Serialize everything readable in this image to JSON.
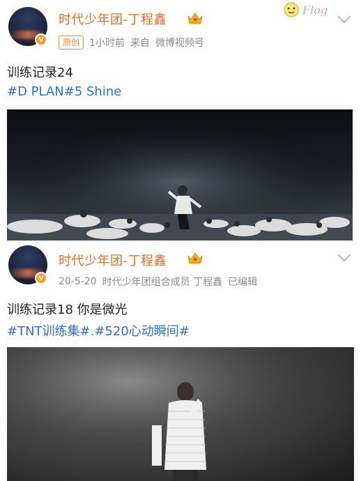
{
  "posts": [
    {
      "username": "时代少年团-丁程鑫",
      "original_tag": "原创",
      "time": "1小时前",
      "source_prefix": "来自",
      "source": "微博视频号",
      "text": "训练记录24",
      "topics": "#D PLAN#5 Shine",
      "media_type": "video"
    },
    {
      "username": "时代少年团-丁程鑫",
      "date": "20-5-20",
      "identity": "时代少年团组合成员 丁程鑫",
      "edited": "已编辑",
      "text": "训练记录18 你是微光",
      "topics": "#TNT训练集#.#520心动瞬间#",
      "media_type": "photo"
    }
  ],
  "verified_badge": "V",
  "sticker_text": "Flog",
  "colors": {
    "username": "#f26b1d",
    "topic_link": "#2b6fcf",
    "meta": "#8a8a8a",
    "verified": "#ff9a1f"
  },
  "icons": [
    "crown-icon",
    "verified-badge-icon",
    "chevron-down-icon"
  ]
}
